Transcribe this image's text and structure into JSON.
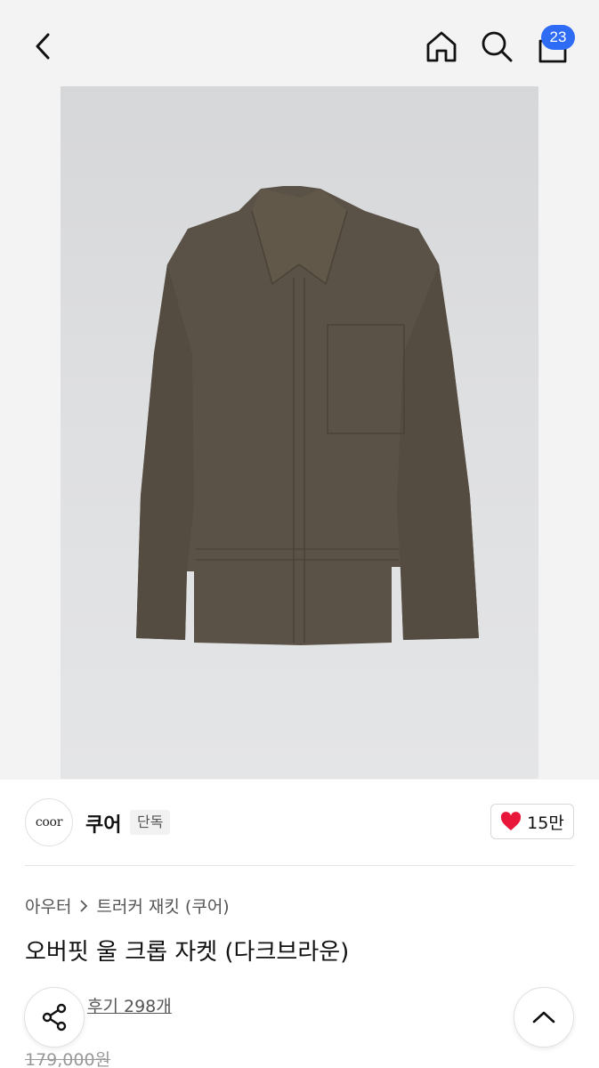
{
  "header": {
    "back_icon": "chevron-left-icon",
    "home_icon": "home-icon",
    "search_icon": "search-icon",
    "cart_icon": "shopping-bag-icon",
    "cart_count": "23",
    "badge_color": "#2f6cf6"
  },
  "product_image": {
    "subject": "jacket",
    "jacket_color": "#5b5247",
    "background_color": "#dcdddf"
  },
  "brand": {
    "logo_text": "coor",
    "name": "쿠어",
    "tag": "단독",
    "like_icon": "heart-icon",
    "like_color": "#e8173a",
    "like_count": "15만"
  },
  "breadcrumb": {
    "items": [
      "아우터",
      "트러커 재킷 (쿠어)"
    ],
    "separator_icon": "chevron-right-icon"
  },
  "product": {
    "title": "오버핏 울 크롭 자켓 (다크브라운)",
    "review_link": "후기 298개",
    "original_price": "179,000원"
  },
  "floating": {
    "share_icon": "share-icon",
    "scroll_top_icon": "chevron-up-icon"
  }
}
